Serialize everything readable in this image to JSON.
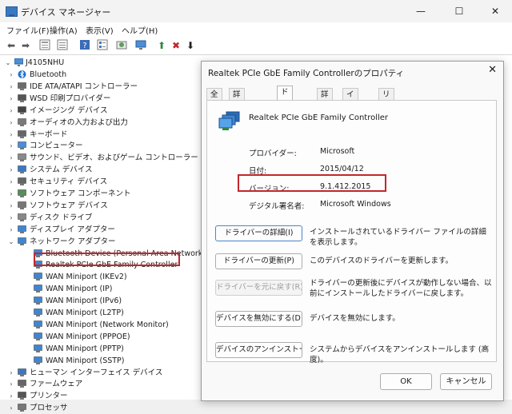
{
  "window": {
    "title": "デバイス マネージャー",
    "minimize": "—",
    "maximize": "☐",
    "close": "✕"
  },
  "menu": [
    "ファイル(F)",
    "操作(A)",
    "表示(V)",
    "ヘルプ(H)"
  ],
  "toolbar_icons": [
    "back-arrow-icon",
    "forward-arrow-icon",
    "properties-icon",
    "show-hide-icon",
    "help-icon",
    "details-icon",
    "scan-hardware-icon",
    "monitor-icon",
    "update-driver-icon",
    "uninstall-icon",
    "disable-icon"
  ],
  "tree": {
    "root": "J4105NHU",
    "items": [
      {
        "label": "Bluetooth",
        "caret": "›",
        "icon": "bluetooth-icon"
      },
      {
        "label": "IDE ATA/ATAPI コントローラー",
        "caret": "›",
        "icon": "controller-icon"
      },
      {
        "label": "WSD 印刷プロバイダー",
        "caret": "›",
        "icon": "printer-icon"
      },
      {
        "label": "イメージング デバイス",
        "caret": "›",
        "icon": "camera-icon"
      },
      {
        "label": "オーディオの入力および出力",
        "caret": "›",
        "icon": "speaker-icon"
      },
      {
        "label": "キーボード",
        "caret": "›",
        "icon": "keyboard-icon"
      },
      {
        "label": "コンピューター",
        "caret": "›",
        "icon": "computer-icon"
      },
      {
        "label": "サウンド、ビデオ、およびゲーム コントローラー",
        "caret": "›",
        "icon": "sound-icon"
      },
      {
        "label": "システム デバイス",
        "caret": "›",
        "icon": "system-icon"
      },
      {
        "label": "セキュリティ デバイス",
        "caret": "›",
        "icon": "security-icon"
      },
      {
        "label": "ソフトウェア コンポーネント",
        "caret": "›",
        "icon": "component-icon"
      },
      {
        "label": "ソフトウェア デバイス",
        "caret": "›",
        "icon": "software-icon"
      },
      {
        "label": "ディスク ドライブ",
        "caret": "›",
        "icon": "disk-icon"
      },
      {
        "label": "ディスプレイ アダプター",
        "caret": "›",
        "icon": "display-icon"
      },
      {
        "label": "ネットワーク アダプター",
        "caret": "⌄",
        "icon": "network-icon"
      },
      {
        "label": "Bluetooth Device (Personal Area Network)",
        "caret": "",
        "icon": "network-adapter-icon",
        "child": true
      },
      {
        "label": "Realtek PCIe GbE Family Controller",
        "caret": "",
        "icon": "network-adapter-icon",
        "child": true,
        "highlight": true
      },
      {
        "label": "WAN Miniport (IKEv2)",
        "caret": "",
        "icon": "network-adapter-icon",
        "child": true
      },
      {
        "label": "WAN Miniport (IP)",
        "caret": "",
        "icon": "network-adapter-icon",
        "child": true
      },
      {
        "label": "WAN Miniport (IPv6)",
        "caret": "",
        "icon": "network-adapter-icon",
        "child": true
      },
      {
        "label": "WAN Miniport (L2TP)",
        "caret": "",
        "icon": "network-adapter-icon",
        "child": true
      },
      {
        "label": "WAN Miniport (Network Monitor)",
        "caret": "",
        "icon": "network-adapter-icon",
        "child": true
      },
      {
        "label": "WAN Miniport (PPPOE)",
        "caret": "",
        "icon": "network-adapter-icon",
        "child": true
      },
      {
        "label": "WAN Miniport (PPTP)",
        "caret": "",
        "icon": "network-adapter-icon",
        "child": true
      },
      {
        "label": "WAN Miniport (SSTP)",
        "caret": "",
        "icon": "network-adapter-icon",
        "child": true
      },
      {
        "label": "ヒューマン インターフェイス デバイス",
        "caret": "›",
        "icon": "hid-icon"
      },
      {
        "label": "ファームウェア",
        "caret": "›",
        "icon": "firmware-icon"
      },
      {
        "label": "プリンター",
        "caret": "›",
        "icon": "printer-icon"
      },
      {
        "label": "プロセッサ",
        "caret": "›",
        "icon": "processor-icon"
      }
    ]
  },
  "dialog": {
    "title": "Realtek PCIe GbE Family Controllerのプロパティ",
    "close": "✕",
    "tabs": [
      "全般",
      "詳細設定",
      "ドライバー",
      "詳細",
      "イベント",
      "リソース"
    ],
    "active_tab": "ドライバー",
    "device_name": "Realtek PCIe GbE Family Controller",
    "props": [
      {
        "label": "プロバイダー:",
        "value": "Microsoft"
      },
      {
        "label": "日付:",
        "value": "2015/04/12"
      },
      {
        "label": "バージョン:",
        "value": "9.1.412.2015"
      },
      {
        "label": "デジタル署名者:",
        "value": "Microsoft Windows"
      }
    ],
    "actions": [
      {
        "button": "ドライバーの詳細(I)",
        "desc": "インストールされているドライバー ファイルの詳細を表示します。",
        "state": "primary"
      },
      {
        "button": "ドライバーの更新(P)",
        "desc": "このデバイスのドライバーを更新します。",
        "state": "normal"
      },
      {
        "button": "ドライバーを元に戻す(R)",
        "desc": "ドライバーの更新後にデバイスが動作しない場合、以前にインストールしたドライバーに戻します。",
        "state": "disabled"
      },
      {
        "button": "デバイスを無効にする(D)",
        "desc": "デバイスを無効にします。",
        "state": "normal"
      },
      {
        "button": "デバイスのアンインストール(U)",
        "desc": "システムからデバイスをアンインストールします (高度)。",
        "state": "normal"
      }
    ],
    "ok": "OK",
    "cancel": "キャンセル"
  },
  "colors": {
    "highlight_box": "#c1272d",
    "accent": "#3a79c2"
  }
}
